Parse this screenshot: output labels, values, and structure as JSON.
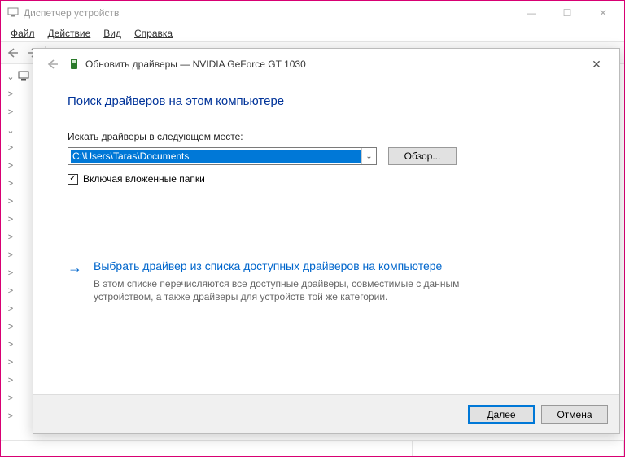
{
  "window": {
    "title": "Диспетчер устройств"
  },
  "menu": {
    "file": "Файл",
    "action": "Действие",
    "view": "Вид",
    "help": "Справка"
  },
  "dialog": {
    "title": "Обновить драйверы — NVIDIA GeForce GT 1030",
    "heading": "Поиск драйверов на этом компьютере",
    "search_label": "Искать драйверы в следующем месте:",
    "path_value": "C:\\Users\\Taras\\Documents",
    "browse_label": "Обзор...",
    "include_subfolders_label": "Включая вложенные папки",
    "include_subfolders_checked": true,
    "option": {
      "title": "Выбрать драйвер из списка доступных драйверов на компьютере",
      "description": "В этом списке перечисляются все доступные драйверы, совместимые с данным устройством, а также драйверы для устройств той же категории."
    },
    "next_label": "Далее",
    "cancel_label": "Отмена"
  },
  "icons": {
    "back_arrow": "←",
    "right_arrow": "→",
    "close": "✕",
    "check": "✓",
    "dropdown": "⌄",
    "expander_closed": ">",
    "expander_open": "⌄",
    "minimize": "—",
    "maximize": "☐"
  }
}
